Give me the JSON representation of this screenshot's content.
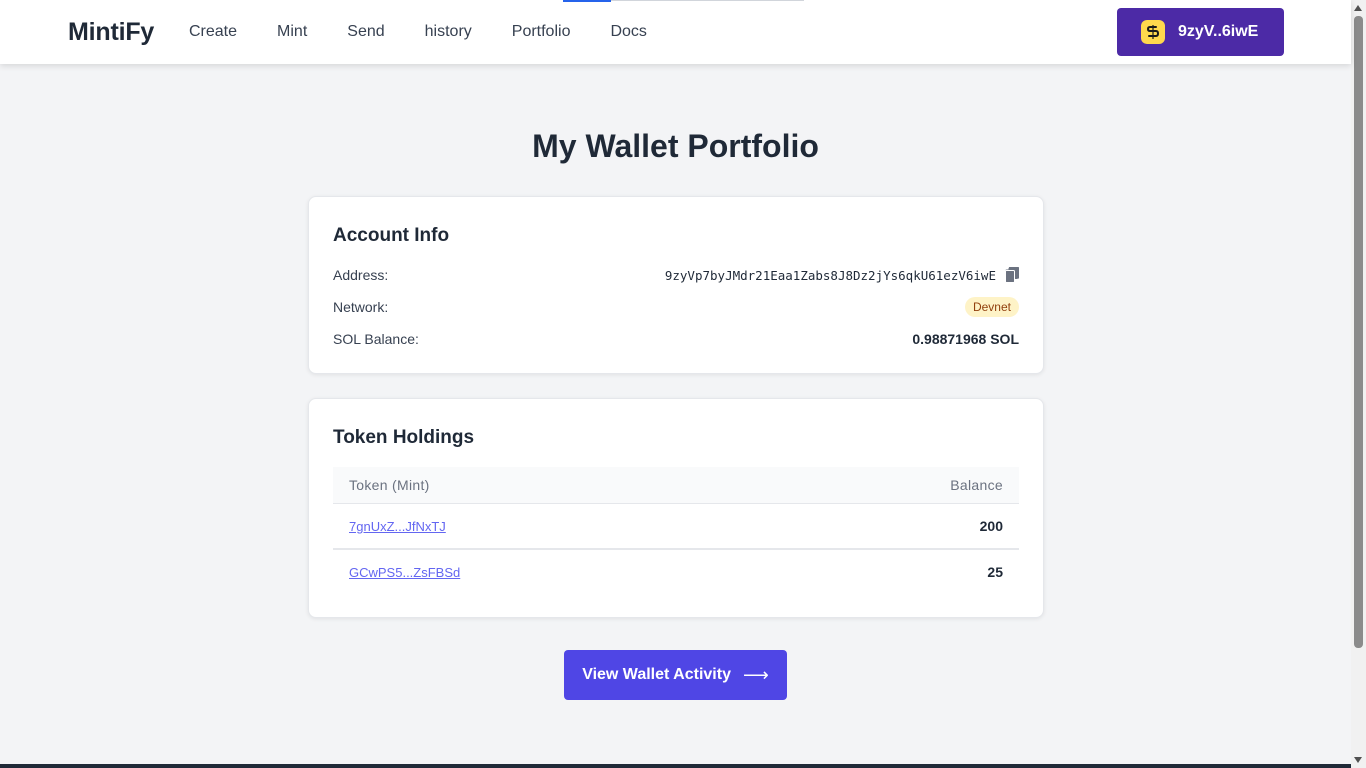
{
  "nav": {
    "brand": "MintiFy",
    "links": [
      {
        "label": "Create"
      },
      {
        "label": "Mint"
      },
      {
        "label": "Send"
      },
      {
        "label": "history"
      },
      {
        "label": "Portfolio"
      },
      {
        "label": "Docs"
      }
    ],
    "wallet_label": "9zyV..6iwE",
    "wallet_icon": "solflare-icon"
  },
  "page": {
    "title": "My Wallet Portfolio"
  },
  "account": {
    "title": "Account Info",
    "address_label": "Address:",
    "address_value": "9zyVp7byJMdr21Eaa1Zabs8J8Dz2jYs6qkU61ezV6iwE",
    "network_label": "Network:",
    "network_value": "Devnet",
    "balance_label": "SOL Balance:",
    "balance_value": "0.98871968 SOL"
  },
  "tokens": {
    "title": "Token Holdings",
    "columns": [
      "Token (Mint)",
      "Balance"
    ],
    "rows": [
      {
        "mint": "7gnUxZ...JfNxTJ",
        "balance": "200"
      },
      {
        "mint": "GCwPS5...ZsFBSd",
        "balance": "25"
      }
    ]
  },
  "activity_button": {
    "label": "View Wallet Activity",
    "icon": "arrow-right-icon"
  },
  "colors": {
    "wallet_button": "#4c2aa6",
    "primary_button": "#4f46e5",
    "link": "#6366f1",
    "badge_bg": "#fef3c7",
    "page_bg": "#f3f4f6"
  }
}
